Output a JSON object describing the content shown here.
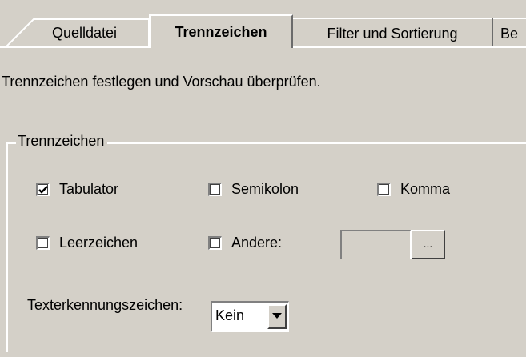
{
  "tabs": [
    {
      "label": "Quelldatei",
      "active": false
    },
    {
      "label": "Trennzeichen",
      "active": true
    },
    {
      "label": "Filter und Sortierung",
      "active": false
    },
    {
      "label": "Be",
      "active": false
    }
  ],
  "intro_text": "Trennzeichen festlegen und Vorschau überprüfen.",
  "group": {
    "title": "Trennzeichen",
    "checkboxes": [
      {
        "label": "Tabulator",
        "checked": true
      },
      {
        "label": "Semikolon",
        "checked": false
      },
      {
        "label": "Komma",
        "checked": false
      },
      {
        "label": "Leerzeichen",
        "checked": false
      },
      {
        "label": "Andere:",
        "checked": false
      }
    ],
    "other_value": "",
    "browse_label": "...",
    "qualifier_label": "Texterkennungszeichen:",
    "qualifier_value": "Kein"
  }
}
